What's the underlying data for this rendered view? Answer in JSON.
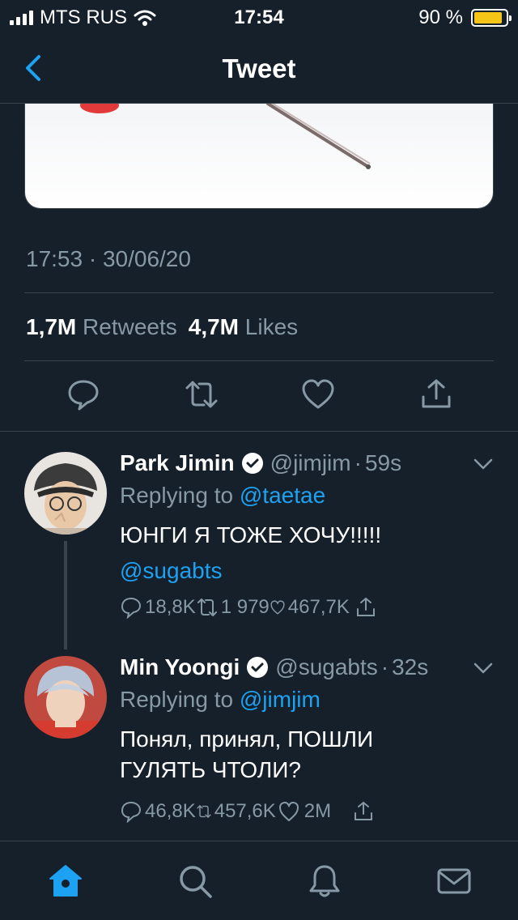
{
  "status_bar": {
    "carrier": "MTS RUS",
    "time": "17:54",
    "battery": "90 %",
    "battery_level": 0.9
  },
  "nav": {
    "title": "Tweet",
    "back_icon": "chevron-left-icon"
  },
  "tweet": {
    "timestamp": "17:53 · 30/06/20",
    "retweets_count": "1,7M",
    "retweets_label": "Retweets",
    "likes_count": "4,7M",
    "likes_label": "Likes",
    "actions": [
      "reply-icon",
      "retweet-icon",
      "like-icon",
      "share-icon"
    ]
  },
  "replies": [
    {
      "name": "Park Jimin",
      "handle": "@jimjim",
      "time": "59s",
      "replying_prefix": "Replying to",
      "replying_to": "@taetae",
      "text": "ЮНГИ Я ТОЖЕ ХОЧУ!!!!!",
      "mention": "@sugabts",
      "replies": "18,8K",
      "retweets": "1 979",
      "likes": "467,7K"
    },
    {
      "name": "Min Yoongi",
      "handle": "@sugabts",
      "time": "32s",
      "replying_prefix": "Replying to",
      "replying_to": "@jimjim",
      "text": "Понял, принял, ПОШЛИ ГУЛЯТЬ ЧТОЛИ?",
      "replies": "46,8K",
      "retweets": "457,6K",
      "likes": "2M"
    }
  ],
  "tabbar": [
    "home-icon",
    "search-icon",
    "notifications-icon",
    "messages-icon"
  ],
  "colors": {
    "background": "#15202b",
    "accent": "#1da1f2",
    "muted": "#8899a6",
    "divider": "#38444d"
  }
}
